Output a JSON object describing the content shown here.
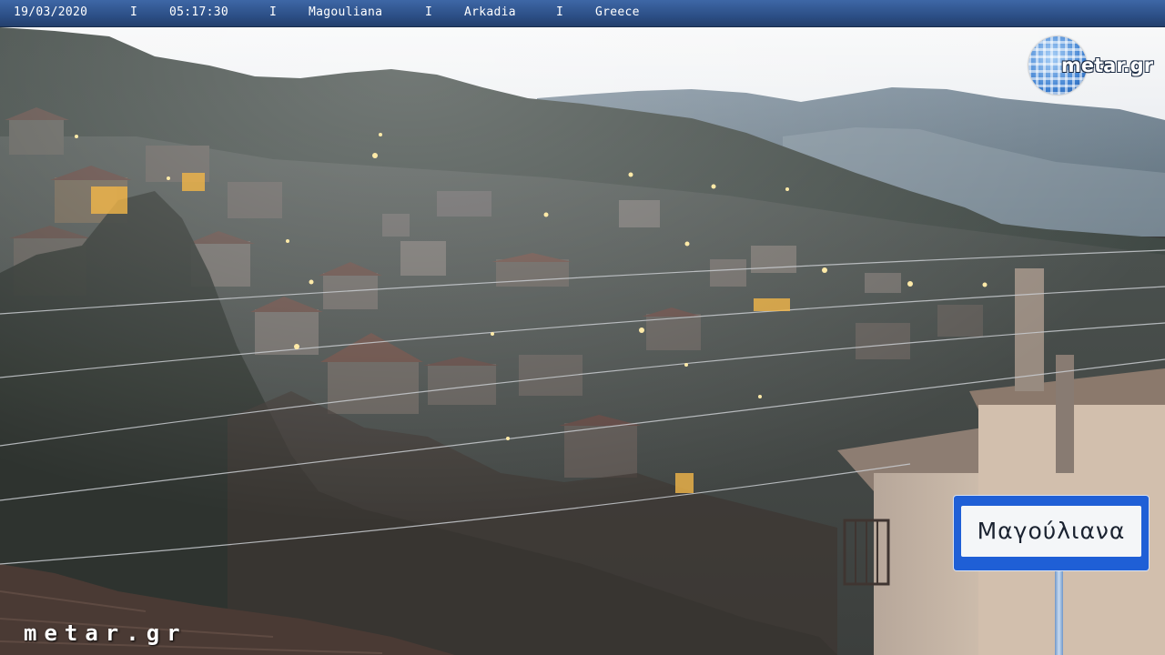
{
  "header": {
    "date": "19/03/2020",
    "time": "05:17:30",
    "location": "Magouliana",
    "region": "Arkadia",
    "country": "Greece",
    "separator": "I"
  },
  "logo": {
    "text": "metar.gr",
    "icon": "globe-icon",
    "color": "#3d7fd0"
  },
  "watermark": {
    "text": "metar.gr"
  },
  "sign": {
    "text": "Μαγούλιανα",
    "color": "#1f5fd6"
  },
  "colors": {
    "bar": "#2c4f86",
    "sky": "#eef1f4",
    "lamp": "#ffe9a8"
  }
}
